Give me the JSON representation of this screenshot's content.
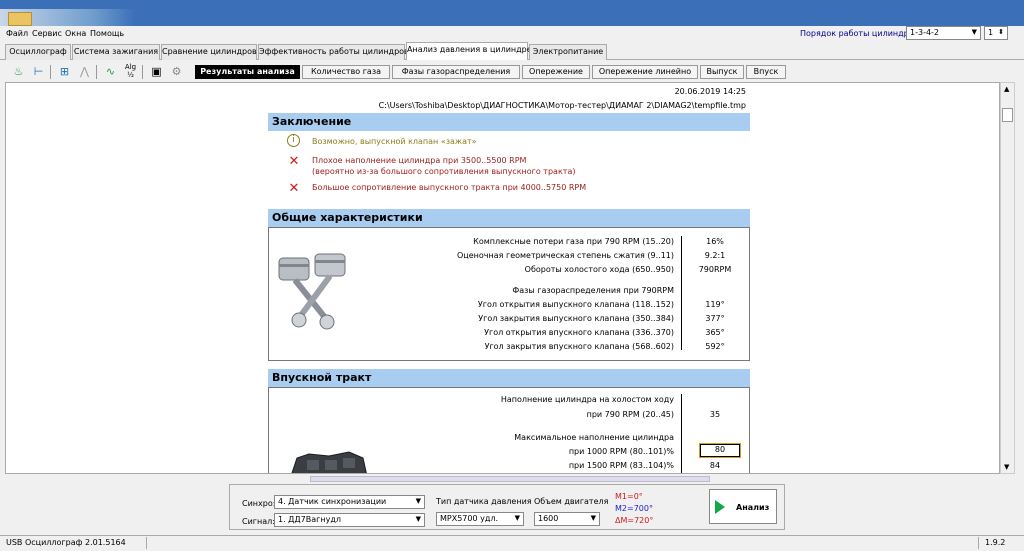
{
  "menu": [
    "Файл",
    "Сервис",
    "Окна",
    "Помощь"
  ],
  "order": {
    "label": "Порядок работы цилиндров",
    "value": "1-3-4-2",
    "cyl": "1"
  },
  "tabs": [
    "Осциллограф",
    "Система зажигания",
    "Сравнение цилиндров",
    "Эффективность работы цилиндров",
    "Анализ давления в цилиндре",
    "Электропитание"
  ],
  "subtabs": [
    "Результаты анализа",
    "Количество газа",
    "Фазы газораспределения",
    "Опережение",
    "Опережение линейно",
    "Выпуск",
    "Впуск"
  ],
  "report": {
    "date": "20.06.2019 14:25",
    "path": "C:\\Users\\Toshiba\\Desktop\\ДИАГНОСТИКА\\Мотор-тестер\\ДИАМАГ 2\\DIAMAG2\\tempfile.tmp",
    "conclusion_title": "Заключение",
    "conclusions": [
      {
        "icon": "info-icon",
        "color": "#8b7d1a",
        "text": "Возможно, выпускной клапан «зажат»"
      },
      {
        "icon": "cross-icon",
        "color": "#9b1c1c",
        "text": "Плохое наполнение цилиндра при 3500..5500 RPM",
        "text2": "(вероятно из-за большого сопротивления выпускного тракта)"
      },
      {
        "icon": "cross-icon",
        "color": "#9b1c1c",
        "text": "Большое сопротивление выпускного тракта при 4000..5750 RPM"
      }
    ],
    "general_title": "Общие характеристики",
    "general": [
      {
        "label": "Комплексные потери газа при 790 RPM (15..20)",
        "value": "16%"
      },
      {
        "label": "Оценочная геометрическая степень сжатия (9..11)",
        "value": "9.2:1"
      },
      {
        "label": "Обороты холостого хода (650..950)",
        "value": "790RPM"
      }
    ],
    "phases_title": "Фазы газораспределения при 790RPM",
    "phases": [
      {
        "label": "Угол открытия выпускного клапана (118..152)",
        "value": "119°"
      },
      {
        "label": "Угол закрытия выпускного клапана (350..384)",
        "value": "377°"
      },
      {
        "label": "Угол открытия впускного клапана (336..370)",
        "value": "365°"
      },
      {
        "label": "Угол закрытия впускного клапана (568..602)",
        "value": "592°"
      }
    ],
    "intake_title": "Впускной тракт",
    "idle_fill_label1": "Наполнение цилиндра на холостом ходу",
    "idle_fill_label2": "при 790 RPM (20..45)",
    "idle_fill_value": "35",
    "max_fill_label": "Максимальное наполнение цилиндра",
    "max_fill": [
      {
        "label": "при 1000 RPM (80..101)%",
        "value": "80"
      },
      {
        "label": "при 1500 RPM (83..104)%",
        "value": "84"
      }
    ]
  },
  "controls": {
    "sync_label": "Синхро:",
    "sync_value": "4. Датчик синхронизации",
    "signal_label": "Сигнал:",
    "signal_value": "1. ДД7Вагнудл",
    "sensor_label": "Тип датчика давления",
    "sensor_value": "MPX5700 удл.",
    "volume_label": "Объем двигателя",
    "volume_value": "1600",
    "m1": "M1=0°",
    "m2": "M2=700°",
    "dm": "ΔM=720°",
    "analyze": "Анализ"
  },
  "status": {
    "left": "USB Осциллограф  2.01.5164",
    "right": "1.9.2"
  },
  "colors": {
    "section_header": "#a8cdf0",
    "m1": "#d01a1a",
    "m2": "#2020d0",
    "dm": "#d01a1a",
    "play": "#11a84a"
  }
}
